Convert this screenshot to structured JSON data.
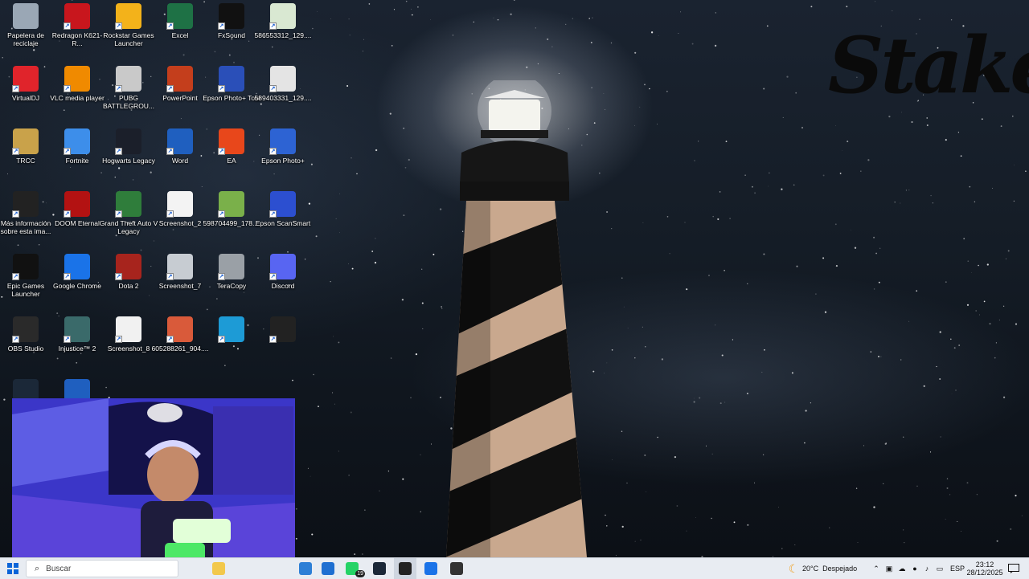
{
  "desktop": {
    "brand_logo": "Stake",
    "icons": [
      {
        "label": "Papelera de reciclaje",
        "icon": "recycle-bin-icon",
        "color": "#9aa7b5"
      },
      {
        "label": "Redragon K621-R...",
        "icon": "redragon-icon",
        "color": "#c8161d"
      },
      {
        "label": "Rockstar Games Launcher",
        "icon": "rockstar-icon",
        "color": "#f3b21a"
      },
      {
        "label": "Excel",
        "icon": "excel-icon",
        "color": "#1e7145"
      },
      {
        "label": "FxSound",
        "icon": "fxsound-icon",
        "color": "#111111"
      },
      {
        "label": "586553312_129....",
        "icon": "image-file-icon",
        "color": "#d9e8d2"
      },
      {
        "label": "VirtualDJ",
        "icon": "virtualdj-icon",
        "color": "#e0242b"
      },
      {
        "label": "VLC media player",
        "icon": "vlc-icon",
        "color": "#f08a00"
      },
      {
        "label": "PUBG BATTLEGROU...",
        "icon": "pubg-icon",
        "color": "#c9c9c9"
      },
      {
        "label": "PowerPoint",
        "icon": "powerpoint-icon",
        "color": "#c43e1c"
      },
      {
        "label": "Epson Photo+ Tool",
        "icon": "epson-photo-tool-icon",
        "color": "#2a4fb8"
      },
      {
        "label": "589403331_129....",
        "icon": "image-file-icon",
        "color": "#e4e4e4"
      },
      {
        "label": "TRCC",
        "icon": "folder-icon",
        "color": "#c9a24a"
      },
      {
        "label": "Fortnite",
        "icon": "fortnite-icon",
        "color": "#3d8eea"
      },
      {
        "label": "Hogwarts Legacy",
        "icon": "hogwarts-icon",
        "color": "#1b1f2a"
      },
      {
        "label": "Word",
        "icon": "word-icon",
        "color": "#1f5fbf"
      },
      {
        "label": "EA",
        "icon": "ea-icon",
        "color": "#e8471b"
      },
      {
        "label": "Epson Photo+",
        "icon": "epson-photo-icon",
        "color": "#2d63d3"
      },
      {
        "label": "Más información sobre esta ima...",
        "icon": "info-icon",
        "color": "#222222"
      },
      {
        "label": "DOOM Eternal",
        "icon": "doom-icon",
        "color": "#b31212"
      },
      {
        "label": "Grand Theft Auto V Legacy",
        "icon": "gta-icon",
        "color": "#2f7d3b"
      },
      {
        "label": "Screenshot_2",
        "icon": "screenshot-file-icon",
        "color": "#f3f3f3"
      },
      {
        "label": "598704499_178....",
        "icon": "image-file-icon",
        "color": "#7ab04a"
      },
      {
        "label": "Epson ScanSmart",
        "icon": "epson-scansmart-icon",
        "color": "#2c4fd0"
      },
      {
        "label": "Epic Games Launcher",
        "icon": "epic-games-icon",
        "color": "#111111"
      },
      {
        "label": "Google Chrome",
        "icon": "chrome-icon",
        "color": "#1a73e8"
      },
      {
        "label": "Dota 2",
        "icon": "dota-icon",
        "color": "#a7241d"
      },
      {
        "label": "Screenshot_7",
        "icon": "screenshot-file-icon",
        "color": "#c7ccd2"
      },
      {
        "label": "TeraCopy",
        "icon": "teracopy-icon",
        "color": "#9aa0a6"
      },
      {
        "label": "Discord",
        "icon": "discord-icon",
        "color": "#5865f2"
      },
      {
        "label": "OBS Studio",
        "icon": "obs-icon",
        "color": "#2a2a2a"
      },
      {
        "label": "Injustice™ 2",
        "icon": "injustice-icon",
        "color": "#3a6a6a"
      },
      {
        "label": "Screenshot_8",
        "icon": "screenshot-file-icon",
        "color": "#f1f1f1"
      },
      {
        "label": "605288261_904....",
        "icon": "image-file-icon",
        "color": "#d95a3a"
      },
      {
        "label": "",
        "icon": "edge-icon",
        "color": "#1d9bd6"
      },
      {
        "label": "",
        "icon": "logitech-g-icon",
        "color": "#222222"
      },
      {
        "label": "",
        "icon": "steam-icon",
        "color": "#1b2838"
      },
      {
        "label": "",
        "icon": "word-document-icon",
        "color": "#1f5fbf"
      }
    ]
  },
  "taskbar": {
    "search_placeholder": "Buscar",
    "weather_temp": "20°C",
    "weather_desc": "Despejado",
    "language": "ESP",
    "time": "23:12",
    "date": "28/12/2025",
    "whatsapp_badge": "19",
    "apps": [
      {
        "icon": "file-explorer-icon",
        "color": "#f2c84b"
      },
      {
        "icon": "microsoft-store-icon",
        "color": "#2d7fd6"
      },
      {
        "icon": "outlook-icon",
        "color": "#1f6fd1"
      },
      {
        "icon": "whatsapp-icon",
        "color": "#25d366"
      },
      {
        "icon": "steam-icon",
        "color": "#1b2838"
      },
      {
        "icon": "terminal-icon",
        "color": "#222222"
      },
      {
        "icon": "chrome-icon",
        "color": "#1a73e8"
      },
      {
        "icon": "stake-icon",
        "color": "#333333"
      }
    ]
  }
}
